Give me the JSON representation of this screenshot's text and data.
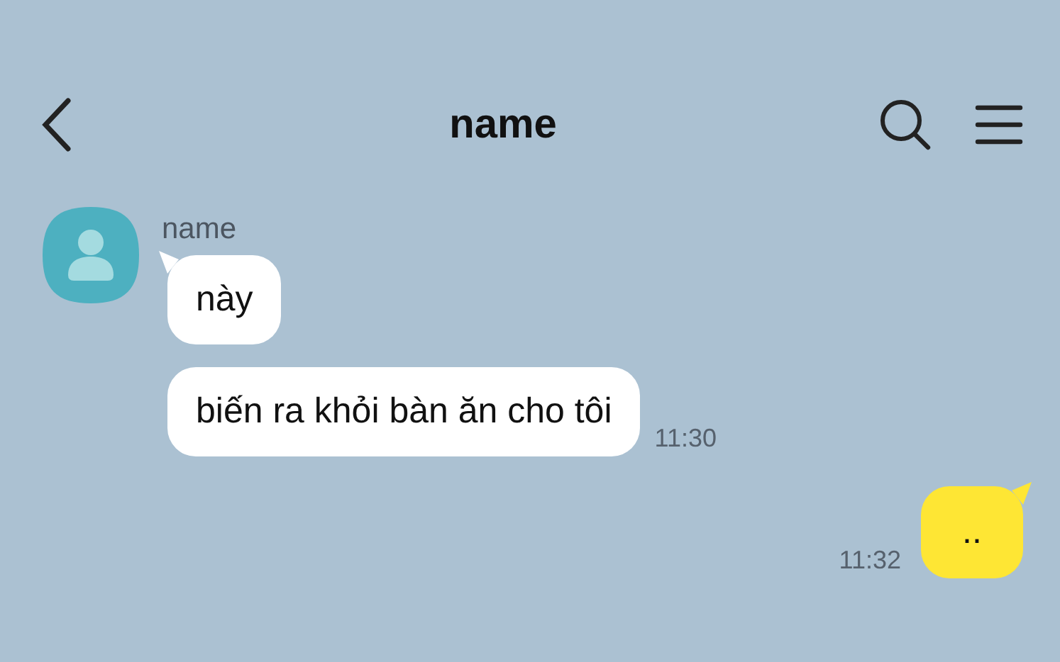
{
  "header": {
    "title": "name"
  },
  "messages": [
    {
      "kind": "received",
      "sender": "name",
      "text": "này",
      "tail": true
    },
    {
      "kind": "received",
      "text": "biến ra khỏi bàn ăn cho tôi",
      "tail": false,
      "time": "11:30"
    },
    {
      "kind": "sent",
      "text": "..",
      "tail": true,
      "time": "11:32"
    }
  ]
}
